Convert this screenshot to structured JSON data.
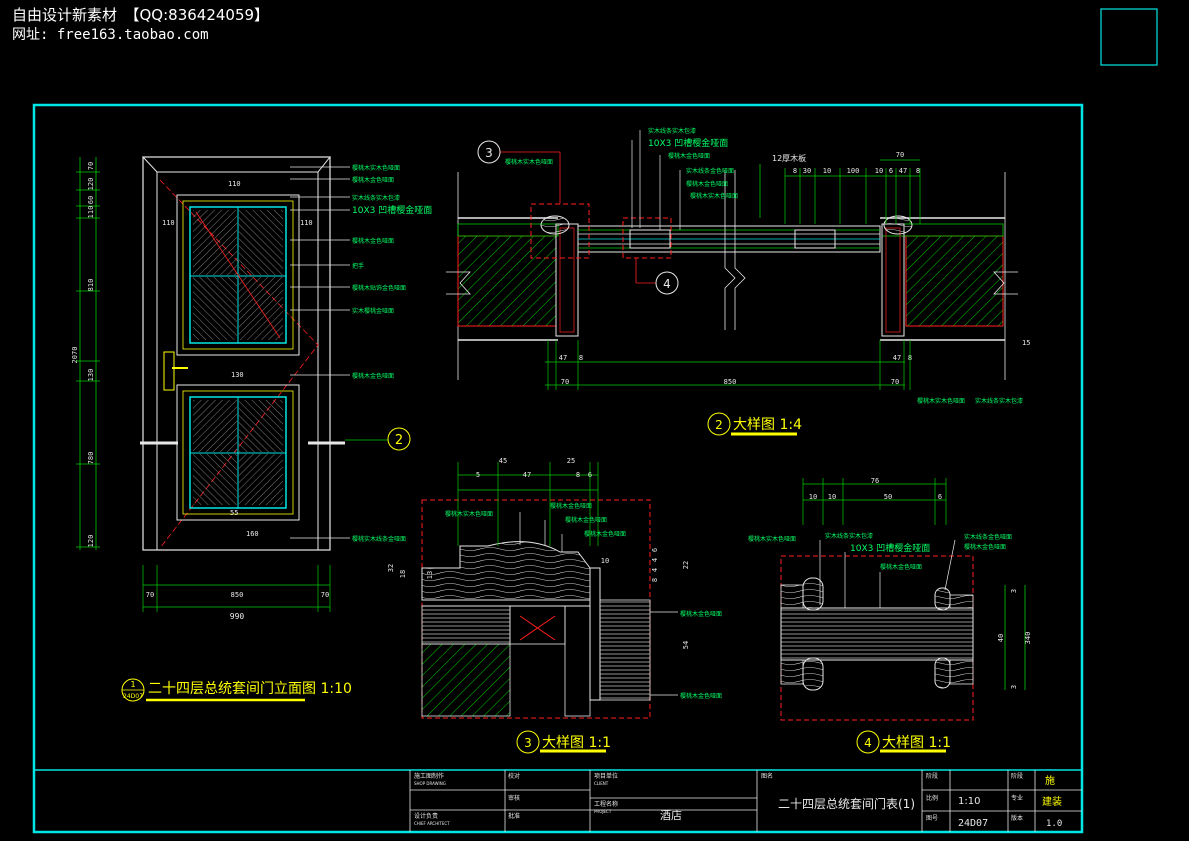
{
  "watermark": {
    "line1": "自由设计新素材　【QQ:836424059】",
    "line2": "网址: free163.taobao.com"
  },
  "colors": {
    "frame": "#00e5e5",
    "drawing": "#e8e8e8",
    "dimension": "#00cc00",
    "callout": "#ff2020",
    "title_underline": "#ffff00",
    "notes": "#00ff66"
  },
  "elevation": {
    "title": "二十四层总统套间门立面图 1:10",
    "ref_top": "1",
    "ref_bottom": "24D07",
    "left_dims": [
      "70",
      "120",
      "60",
      "110",
      "810",
      "2070",
      "130",
      "780",
      "120"
    ],
    "bottom_dims": [
      "70",
      "850",
      "70"
    ],
    "overall_width": "990",
    "inner_dims": [
      "110",
      "110",
      "110",
      "130",
      "55",
      "160"
    ],
    "section_marker": "2",
    "annotations": [
      "樱桃木实木色哑面",
      "樱桃木金色哑面",
      "实木线条实木包漆",
      "10X3 凹槽樱金哑面",
      "樱桃木金色哑面",
      "把手",
      "樱桃木贴饰金色哑面",
      "实木樱桃金哑面",
      "樱桃木金色哑面",
      "樱桃实木线条金哑面"
    ]
  },
  "detail2": {
    "title": "大样图 1:4",
    "number": "2",
    "callout_3": "3",
    "callout_4": "4",
    "top_dims": [
      "70",
      "8",
      "30",
      "10",
      "100",
      "10",
      "6",
      "47",
      "8"
    ],
    "top_note": "12厚木板",
    "bottom_dims": [
      "47",
      "8",
      "70",
      "850",
      "47",
      "8",
      "70"
    ],
    "side_dim": "15",
    "annotations": [
      "樱桃木实木色哑面",
      "实木线条实木包漆",
      "10X3 凹槽樱金哑面",
      "樱桃木金色哑面",
      "实木线条金色哑面",
      "樱桃木金色哑面",
      "樱桃木实木色哑面",
      "樱桃木实木色哑面",
      "实木线条实木包漆"
    ]
  },
  "detail3": {
    "title": "大样图 1:1",
    "number": "3",
    "top_dims": [
      "45",
      "25",
      "5",
      "47",
      "8",
      "6"
    ],
    "left_dims": [
      "32",
      "18",
      "13"
    ],
    "right_dims": [
      "10",
      "6",
      "4",
      "4",
      "8",
      "22",
      "54"
    ],
    "annotations": [
      "樱桃木实木色哑面",
      "樱桃木金色哑面",
      "樱桃木金色哑面",
      "樱桃木金色哑面",
      "樱桃木金色哑面",
      "樱桃木金色哑面"
    ]
  },
  "detail4": {
    "title": "大样图 1:1",
    "number": "4",
    "top_dims": [
      "76",
      "10",
      "10",
      "50",
      "6"
    ],
    "right_dims": [
      "3",
      "40",
      "3",
      "340"
    ],
    "annotations": [
      "樱桃木实木色哑面",
      "实木线条实木包漆",
      "10X3 凹槽樱金哑面",
      "樱桃木金色哑面",
      "实木线条金色哑面",
      "樱桃木金色哑面"
    ]
  },
  "title_block": {
    "col1_row1": "施工图制作",
    "col1_row1_sub": "SHOP DRAWING",
    "col1_row2": "设计负责",
    "col1_row2_sub": "CHIEF ARCHITECT",
    "col2_row1": "校对",
    "col2_row2": "审核",
    "col2_row3": "批准",
    "col3_row1": "项目单位",
    "col3_row1_sub": "CLIENT",
    "col3_row2": "工程名称",
    "col3_row2_sub": "PROJECT",
    "project": "酒店",
    "drawing_title_label": "图名",
    "drawing_title": "二十四层总统套间门表(1)",
    "scale_label": "比例",
    "scale": "1:10",
    "number_label": "图号",
    "number": "24D07",
    "stage_label": "阶段",
    "stage": "施",
    "discipline_label": "专业",
    "discipline": "建装",
    "version_label": "版本",
    "version": "1.0"
  }
}
